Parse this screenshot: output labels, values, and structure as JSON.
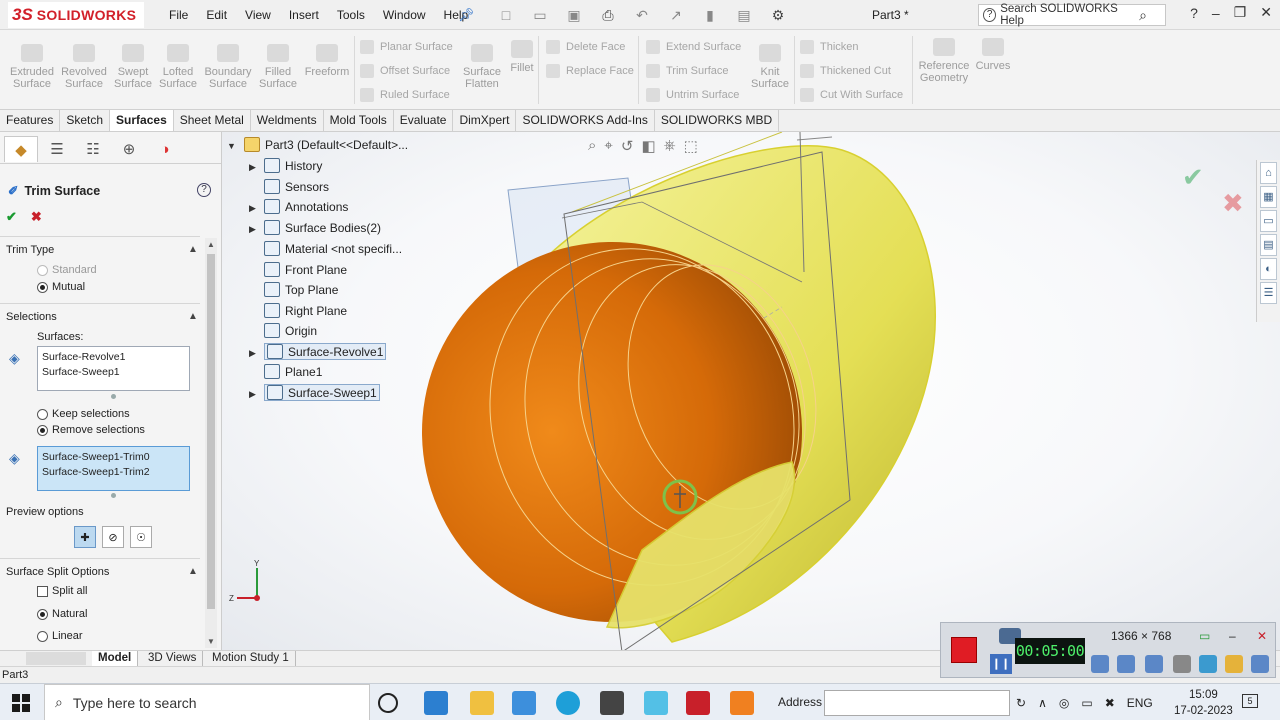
{
  "app": {
    "brand_ds": "3S",
    "brand_name": "SOLIDWORKS",
    "doc_title": "Part3 *"
  },
  "menu": [
    "File",
    "Edit",
    "View",
    "Insert",
    "Tools",
    "Window",
    "Help"
  ],
  "help_search": {
    "placeholder": "Search SOLIDWORKS Help"
  },
  "ribbon": {
    "big": [
      {
        "label": "Extruded\nSurface"
      },
      {
        "label": "Revolved\nSurface"
      },
      {
        "label": "Swept\nSurface"
      },
      {
        "label": "Lofted\nSurface"
      },
      {
        "label": "Boundary\nSurface"
      },
      {
        "label": "Filled\nSurface"
      },
      {
        "label": "Freeform"
      }
    ],
    "group1": [
      "Planar Surface",
      "Offset Surface",
      "Ruled Surface"
    ],
    "flatten": "Surface\nFlatten",
    "fillet": "Fillet",
    "group2": [
      "Delete Face",
      "Replace Face"
    ],
    "group3": [
      "Extend Surface",
      "Trim Surface",
      "Untrim Surface"
    ],
    "knit": "Knit\nSurface",
    "group4": [
      "Thicken",
      "Thickened Cut",
      "Cut With Surface"
    ],
    "refgeo": "Reference\nGeometry",
    "curves": "Curves"
  },
  "command_tabs": [
    "Features",
    "Sketch",
    "Surfaces",
    "Sheet Metal",
    "Weldments",
    "Mold Tools",
    "Evaluate",
    "DimXpert",
    "SOLIDWORKS Add-Ins",
    "SOLIDWORKS MBD"
  ],
  "property_manager": {
    "title": "Trim Surface",
    "trim_type": {
      "header": "Trim Type",
      "standard": "Standard",
      "mutual": "Mutual"
    },
    "selections": {
      "header": "Selections",
      "surfaces_label": "Surfaces:",
      "surfaces": [
        "Surface-Revolve1",
        "Surface-Sweep1"
      ],
      "keep": "Keep selections",
      "remove": "Remove selections",
      "pieces": [
        "Surface-Sweep1-Trim0",
        "Surface-Sweep1-Trim2"
      ]
    },
    "preview": {
      "header": "Preview options"
    },
    "split": {
      "header": "Surface Split Options",
      "split_all": "Split all",
      "natural": "Natural",
      "linear": "Linear"
    }
  },
  "tree": {
    "root": "Part3  (Default<<Default>...",
    "nodes": [
      "History",
      "Sensors",
      "Annotations",
      "Surface Bodies(2)",
      "Material <not specifi...",
      "Front Plane",
      "Top Plane",
      "Right Plane",
      "Origin",
      "Surface-Revolve1",
      "Plane1",
      "Surface-Sweep1"
    ]
  },
  "bottom_tabs": [
    "Model",
    "3D Views",
    "Motion Study 1"
  ],
  "status": {
    "text": "Part3"
  },
  "recorder": {
    "time": "00:05:00",
    "resolution": "1366 × 768"
  },
  "taskbar": {
    "search_placeholder": "Type here to search",
    "address_label": "Address",
    "lang": "ENG",
    "time": "15:09",
    "date": "17-02-2023",
    "notifications": "5"
  },
  "colors": {
    "accent": "#2a6fc9",
    "surface_copper": "#d96a0c",
    "surface_yellow": "#e8e46a",
    "brand": "#d2202a"
  }
}
